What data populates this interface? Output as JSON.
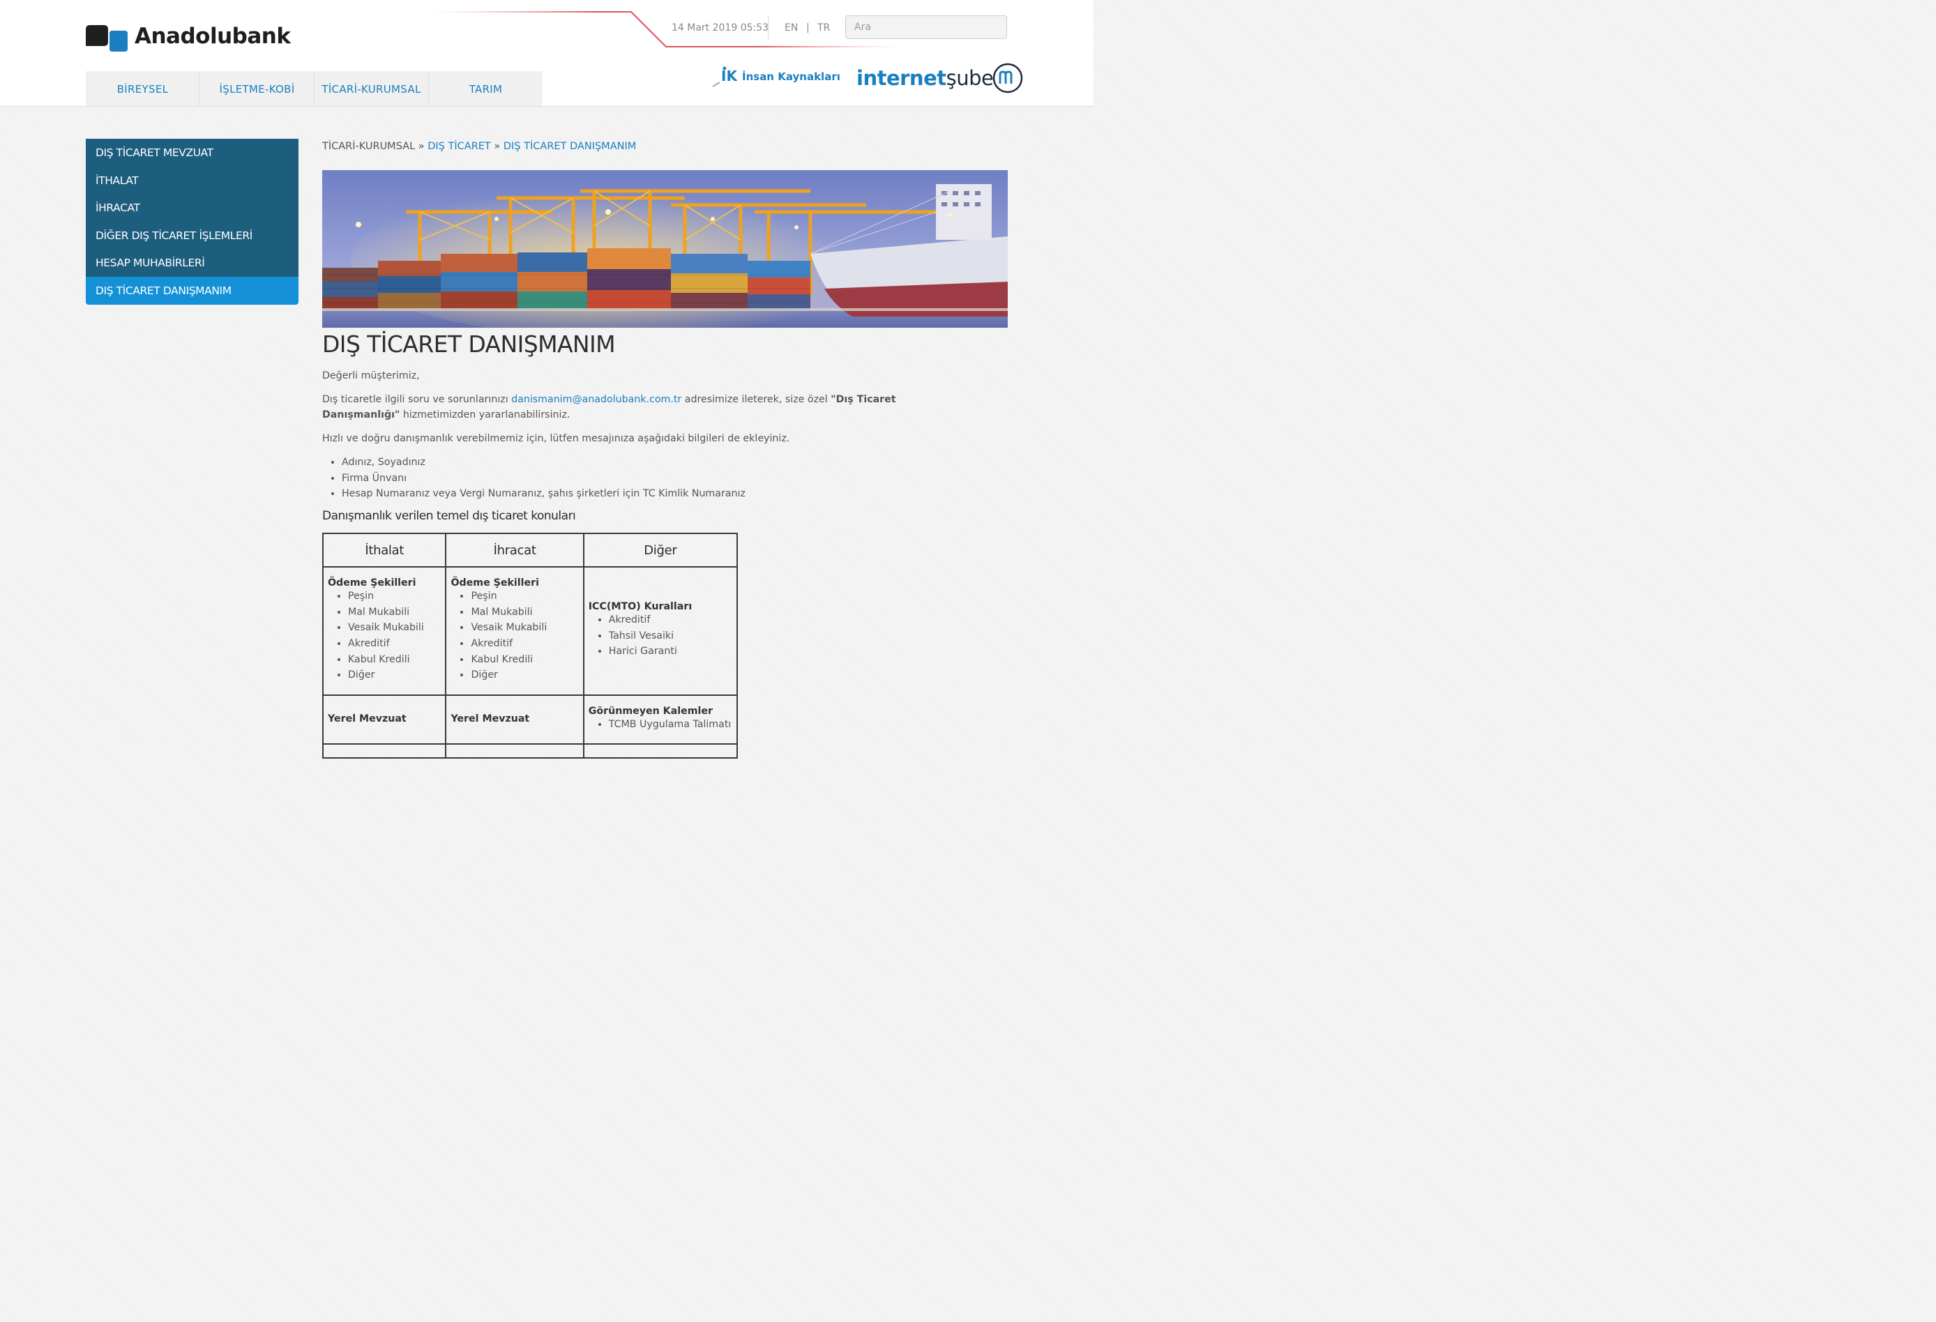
{
  "brand": {
    "name": "Anadolubank",
    "colors": {
      "primary": "#1a7fc1",
      "sidebar": "#1d5d7e",
      "sidebar_active": "#1490d7"
    }
  },
  "topbar": {
    "datetime": "14 Mart 2019 05:53",
    "lang_en": "EN",
    "lang_sep": "|",
    "lang_tr": "TR",
    "search_placeholder": "Ara"
  },
  "nav": {
    "items": [
      "BİREYSEL",
      "İŞLETME-KOBİ",
      "TİCARİ-KURUMSAL",
      "TARIM"
    ]
  },
  "header_links": {
    "ik_logo": "İK",
    "ik_label": "İnsan Kaynakları",
    "isube_part1": "internet",
    "isube_part2": "şube"
  },
  "sidebar": {
    "items": [
      "DIŞ TİCARET MEVZUAT",
      "İTHALAT",
      "İHRACAT",
      "DİĞER DIŞ TİCARET İŞLEMLERİ",
      "HESAP MUHABİRLERİ",
      "DIŞ TİCARET DANIŞMANIM"
    ],
    "active_index": 5
  },
  "breadcrumb": {
    "root": "TİCARİ-KURUMSAL",
    "sep": "»",
    "level1": "DIŞ TİCARET",
    "level2": "DIŞ TİCARET DANIŞMANIM"
  },
  "content": {
    "title": "DIŞ TİCARET DANIŞMANIM",
    "greeting": "Değerli müşterimiz,",
    "p1_before": "Dış ticaretle ilgili soru ve sorunlarınızı ",
    "p1_email": "danismanim@anadolubank.com.tr",
    "p1_middle": " adresimize ileterek, size özel ",
    "p1_bold": "\"Dış Ticaret Danışmanlığı\"",
    "p1_after": " hizmetimizden yararlanabilirsiniz.",
    "p2": "Hızlı ve doğru danışmanlık verebilmemiz için, lütfen mesajınıza aşağıdaki bilgileri de ekleyiniz.",
    "bullets": [
      "Adınız, Soyadınız",
      "Firma Ünvanı",
      "Hesap Numaranız veya Vergi Numaranız, şahıs şirketleri için TC Kimlik Numaranız"
    ],
    "table_heading": "Danışmanlık verilen temel dış ticaret konuları"
  },
  "table": {
    "headers": [
      "İthalat",
      "İhracat",
      "Diğer"
    ],
    "row1": {
      "ithalat_title": "Ödeme Şekilleri",
      "ithalat_items": [
        "Peşin",
        "Mal Mukabili",
        "Vesaik Mukabili",
        "Akreditif",
        "Kabul Kredili",
        "Diğer"
      ],
      "ihracat_title": "Ödeme Şekilleri",
      "ihracat_items": [
        "Peşin",
        "Mal Mukabili",
        "Vesaik Mukabili",
        "Akreditif",
        "Kabul Kredili",
        "Diğer"
      ],
      "diger_title": "ICC(MTO) Kuralları",
      "diger_items": [
        "Akreditif",
        "Tahsil Vesaiki",
        "Harici Garanti"
      ]
    },
    "row2": {
      "ithalat_title": "Yerel Mevzuat",
      "ihracat_title": "Yerel Mevzuat",
      "diger_title": "Görünmeyen Kalemler",
      "diger_items": [
        "TCMB Uygulama Talimatı"
      ]
    }
  }
}
